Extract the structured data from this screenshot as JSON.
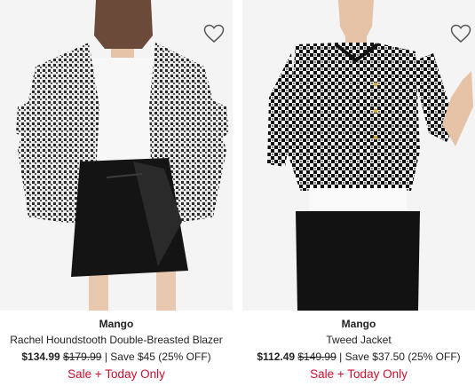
{
  "products": [
    {
      "brand": "Mango",
      "title": "Rachel Houndstooth Double-Breasted Blazer",
      "sale_price": "$134.99",
      "original_price": "$179.99",
      "savings": "| Save $45 (25% OFF)",
      "promo": "Sale + Today Only",
      "favorite_icon": "heart-outline-icon"
    },
    {
      "brand": "Mango",
      "title": "Tweed Jacket",
      "sale_price": "$112.49",
      "original_price": "$149.99",
      "savings": "| Save $37.50 (25% OFF)",
      "promo": "Sale + Today Only",
      "favorite_icon": "heart-outline-icon"
    }
  ],
  "colors": {
    "promo_red": "#c8102e",
    "text": "#222222",
    "image_bg": "#f4f4f4"
  }
}
